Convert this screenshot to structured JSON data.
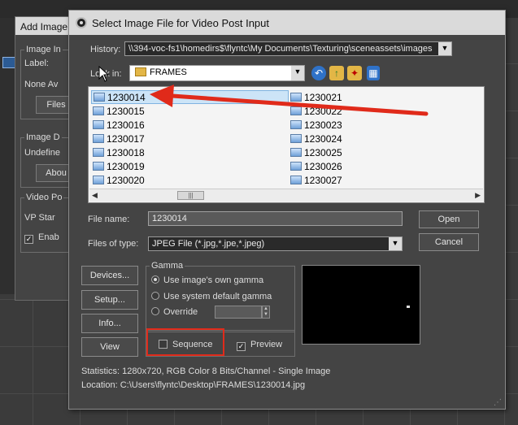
{
  "background": {
    "add_image_dialog": {
      "title": "Add Image",
      "group_image_input": "Image In",
      "label_caption": "Label:",
      "none_available": "None Av",
      "files_button": "Files",
      "group_image_driver": "Image D",
      "undefined_text": "Undefine",
      "about_button": "Abou",
      "group_video_post": "Video Po",
      "vp_start": "VP Star",
      "enable": "Enab"
    }
  },
  "dialog": {
    "title": "Select Image File for Video Post Input",
    "history_label": "History:",
    "history_value": "\\\\394-voc-fs1\\homedirs$\\flyntc\\My Documents\\Texturing\\sceneassets\\images",
    "look_in_label": "Look in:",
    "look_in_value": "FRAMES",
    "files_col1": [
      "1230014",
      "1230015",
      "1230016",
      "1230017",
      "1230018",
      "1230019",
      "1230020"
    ],
    "files_col2": [
      "1230021",
      "1230022",
      "1230023",
      "1230024",
      "1230025",
      "1230026",
      "1230027"
    ],
    "selected_file": "1230014",
    "file_name_label": "File name:",
    "file_name_value": "1230014",
    "files_of_type_label": "Files of type:",
    "files_of_type_value": "JPEG File (*.jpg,*.jpe,*.jpeg)",
    "open_button": "Open",
    "cancel_button": "Cancel",
    "devices_button": "Devices...",
    "setup_button": "Setup...",
    "info_button": "Info...",
    "view_button": "View",
    "gamma_group": "Gamma",
    "gamma_own": "Use image's own gamma",
    "gamma_system": "Use system default gamma",
    "gamma_override": "Override",
    "gamma_selected": "own",
    "sequence_label": "Sequence",
    "sequence_checked": false,
    "preview_label": "Preview",
    "preview_checked": true,
    "statistics_label": "Statistics:",
    "statistics_value": "1280x720, RGB Color 8 Bits/Channel - Single Image",
    "location_label": "Location:",
    "location_value": "C:\\Users\\flyntc\\Desktop\\FRAMES\\1230014.jpg"
  },
  "annotation": {
    "color": "#e02a1a"
  }
}
